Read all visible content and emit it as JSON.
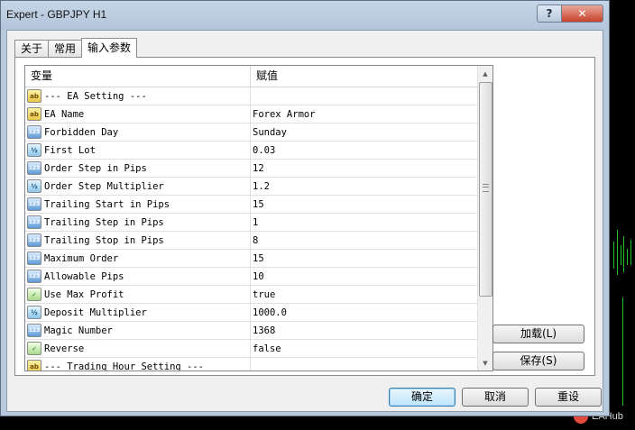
{
  "window": {
    "title": "Expert - GBPJPY H1"
  },
  "caption_buttons": {
    "help": "?",
    "close": "✕"
  },
  "tabs": [
    {
      "label": "关于",
      "active": false
    },
    {
      "label": "常用",
      "active": false
    },
    {
      "label": "输入参数",
      "active": true
    }
  ],
  "grid": {
    "headers": {
      "variable": "变量",
      "value": "赋值"
    },
    "rows": [
      {
        "icon": "string-icon",
        "name": "--- EA Setting ---",
        "value": ""
      },
      {
        "icon": "string-icon",
        "name": "EA Name",
        "value": "Forex Armor"
      },
      {
        "icon": "integer-icon",
        "name": "Forbidden Day",
        "value": "Sunday"
      },
      {
        "icon": "double-icon",
        "name": "First Lot",
        "value": "0.03"
      },
      {
        "icon": "integer-icon",
        "name": "Order Step in Pips",
        "value": "12"
      },
      {
        "icon": "double-icon",
        "name": "Order Step Multiplier",
        "value": "1.2"
      },
      {
        "icon": "integer-icon",
        "name": "Trailing Start in Pips",
        "value": "15"
      },
      {
        "icon": "integer-icon",
        "name": "Trailing Step in Pips",
        "value": "1"
      },
      {
        "icon": "integer-icon",
        "name": "Trailing Stop in Pips",
        "value": "8"
      },
      {
        "icon": "integer-icon",
        "name": "Maximum Order",
        "value": "15"
      },
      {
        "icon": "integer-icon",
        "name": "Allowable Pips",
        "value": "10"
      },
      {
        "icon": "bool-icon",
        "name": "Use Max Profit",
        "value": "true"
      },
      {
        "icon": "double-icon",
        "name": "Deposit Multiplier",
        "value": "1000.0"
      },
      {
        "icon": "integer-icon",
        "name": "Magic Number",
        "value": "1368"
      },
      {
        "icon": "bool-icon",
        "name": "Reverse",
        "value": "false"
      },
      {
        "icon": "string-icon",
        "name": "--- Trading Hour Setting ---",
        "value": ""
      }
    ]
  },
  "icon_glyphs": {
    "string-icon": "ab",
    "integer-icon": "123",
    "double-icon": "½",
    "bool-icon": "✓"
  },
  "side_buttons": {
    "load": "加载(L)",
    "save": "保存(S)"
  },
  "footer_buttons": {
    "ok": "确定",
    "cancel": "取消",
    "reset": "重设"
  },
  "watermark": {
    "text": "EAHub"
  },
  "colors": {
    "chart_green": "#1fbf2a",
    "title_bar": "#b9c9dc",
    "close_red": "#c7412a"
  }
}
